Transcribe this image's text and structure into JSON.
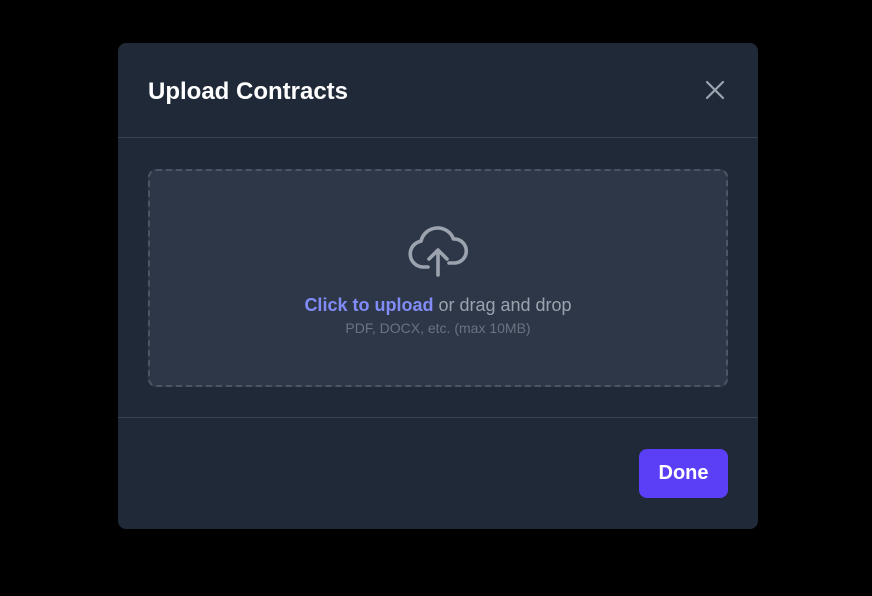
{
  "modal": {
    "title": "Upload Contracts",
    "close_icon": "close-icon",
    "dropzone": {
      "icon": "cloud-upload-icon",
      "link_text": "Click to upload",
      "main_text": " or drag and drop",
      "hint": "PDF, DOCX, etc. (max 10MB)"
    },
    "done_label": "Done"
  },
  "colors": {
    "backdrop": "#000000",
    "modal_bg": "#1f2937",
    "dropzone_bg": "#2d3748",
    "accent_link": "#818cf8",
    "primary_button": "#5b3ff7"
  }
}
